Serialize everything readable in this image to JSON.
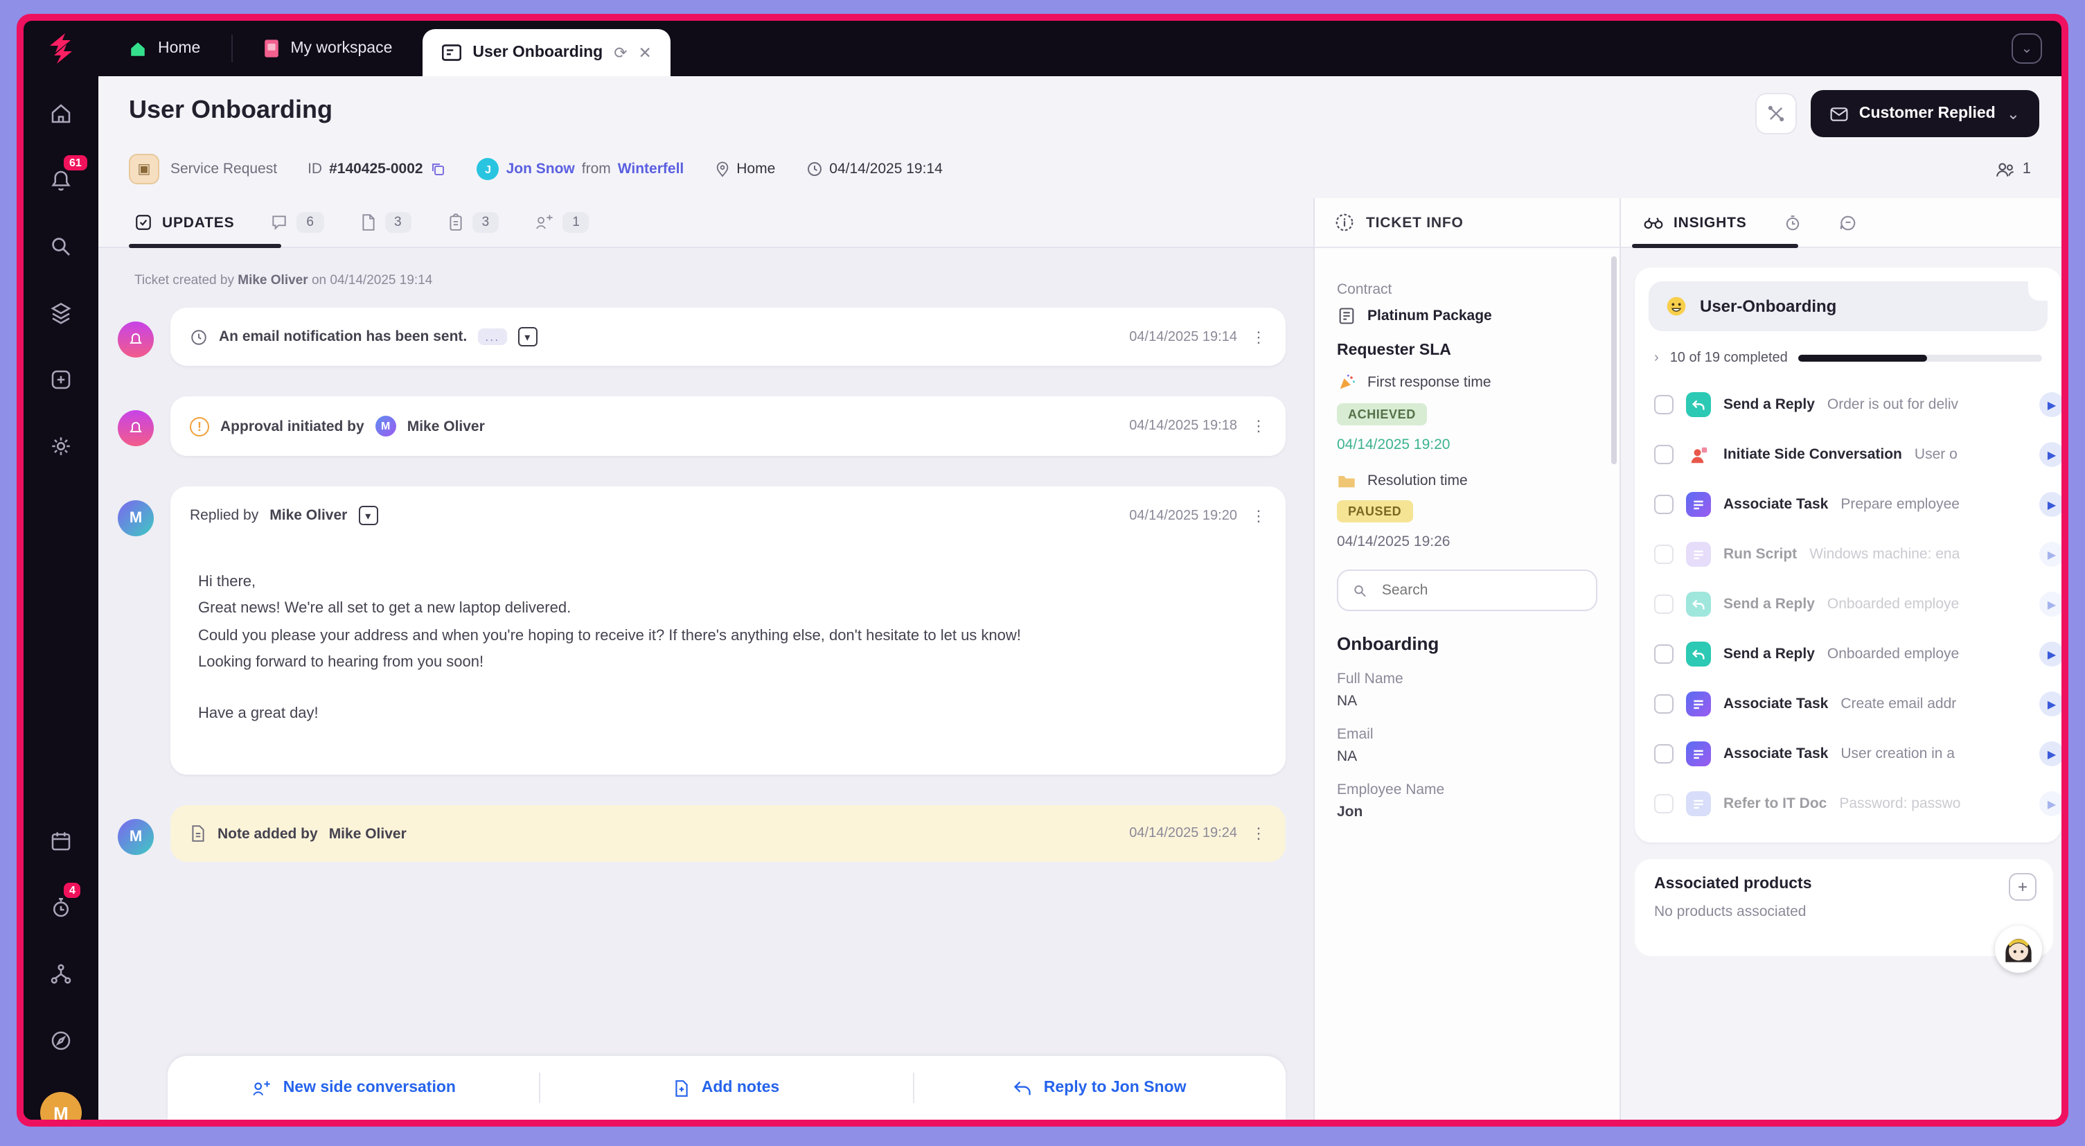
{
  "colors": {
    "frame_outer": "#8f8fe8",
    "frame_inner": "#ee1160",
    "brand_pink": "#ff1f63",
    "dark": "#0f0b17",
    "link_indigo": "#5a5fe0",
    "action_blue": "#2563eb",
    "achieved_bg": "#d8ecd3",
    "paused_bg": "#f6e495",
    "note_bg": "#fbf4d9",
    "progress_dark": "#17151f"
  },
  "topbar": {
    "tabs": [
      {
        "label": "Home"
      },
      {
        "label": "My workspace"
      },
      {
        "label": "User Onboarding"
      }
    ]
  },
  "header": {
    "title": "User Onboarding",
    "status_button": "Customer Replied"
  },
  "meta": {
    "type": "Service Request",
    "id_label": "ID",
    "ticket_id": "#140425-0002",
    "requester": "Jon Snow",
    "requester_initial": "J",
    "from_word": "from",
    "site": "Winterfell",
    "location": "Home",
    "created": "04/14/2025 19:14",
    "followers_count": "1"
  },
  "sidebar": {
    "bell_badge": "61",
    "timer_badge": "4",
    "avatar_initial": "M"
  },
  "updates": {
    "tab": "UPDATES",
    "counts": {
      "comments": "6",
      "attachments": "3",
      "tasks": "3",
      "conversations": "1"
    }
  },
  "timeline": {
    "created": {
      "prefix": "Ticket created by",
      "author": "Mike Oliver",
      "middle": "on",
      "date": "04/14/2025 19:14"
    },
    "email_event": {
      "text": "An email notification has been sent.",
      "dots": "...",
      "date": "04/14/2025 19:14"
    },
    "approval_event": {
      "text": "Approval initiated by",
      "author_initial": "M",
      "author": "Mike Oliver",
      "date": "04/14/2025 19:18"
    },
    "reply_event": {
      "prefix": "Replied by",
      "author": "Mike Oliver",
      "date": "04/14/2025 19:20",
      "body": [
        "Hi there,",
        "Great news! We're all set to get a new laptop delivered.",
        "Could you please your address and when you're hoping to receive it? If there's anything else, don't hesitate to let us know!",
        "Looking forward to hearing from you soon!",
        "Have a great day!"
      ],
      "avatar_initial": "M"
    },
    "note_event": {
      "text": "Note added by",
      "author": "Mike Oliver",
      "date": "04/14/2025 19:24"
    },
    "footer_actions": [
      {
        "label": "New side conversation"
      },
      {
        "label": "Add notes"
      },
      {
        "label": "Reply to Jon Snow"
      }
    ]
  },
  "ticket_info": {
    "title": "TICKET INFO",
    "contract_label": "Contract",
    "contract_value": "Platinum Package",
    "sla_title": "Requester SLA",
    "first_response_label": "First response time",
    "first_response_status": "ACHIEVED",
    "first_response_date": "04/14/2025 19:20",
    "resolution_label": "Resolution time",
    "resolution_status": "PAUSED",
    "resolution_date": "04/14/2025 19:26",
    "search_placeholder": "Search",
    "onboarding_title": "Onboarding",
    "fields": [
      {
        "label": "Full Name",
        "value": "NA"
      },
      {
        "label": "Email",
        "value": "NA"
      },
      {
        "label": "Employee Name",
        "value": "Jon"
      }
    ]
  },
  "insights": {
    "tab": "INSIGHTS",
    "runbook_title": "User-Onboarding",
    "progress_text": "10 of 19 completed",
    "progress_percent": 53,
    "items": [
      {
        "type": "Send a Reply",
        "desc": "Order is out for deliv",
        "icon": "reply",
        "dim": false
      },
      {
        "type": "Initiate Side Conversation",
        "desc": "User o",
        "icon": "person",
        "dim": false
      },
      {
        "type": "Associate Task",
        "desc": "Prepare employee",
        "icon": "task",
        "dim": false
      },
      {
        "type": "Run Script",
        "desc": "Windows machine: ena",
        "icon": "script",
        "dim": true
      },
      {
        "type": "Send a Reply",
        "desc": "Onboarded employe",
        "icon": "reply",
        "dim": true
      },
      {
        "type": "Send a Reply",
        "desc": "Onboarded employe",
        "icon": "reply",
        "dim": false
      },
      {
        "type": "Associate Task",
        "desc": "Create email addr",
        "icon": "task",
        "dim": false
      },
      {
        "type": "Associate Task",
        "desc": "User creation in a",
        "icon": "task",
        "dim": false
      },
      {
        "type": "Refer to IT Doc",
        "desc": "Password: passwo",
        "icon": "doc",
        "dim": true
      }
    ]
  },
  "associated_products": {
    "title": "Associated products",
    "empty": "No products associated"
  }
}
